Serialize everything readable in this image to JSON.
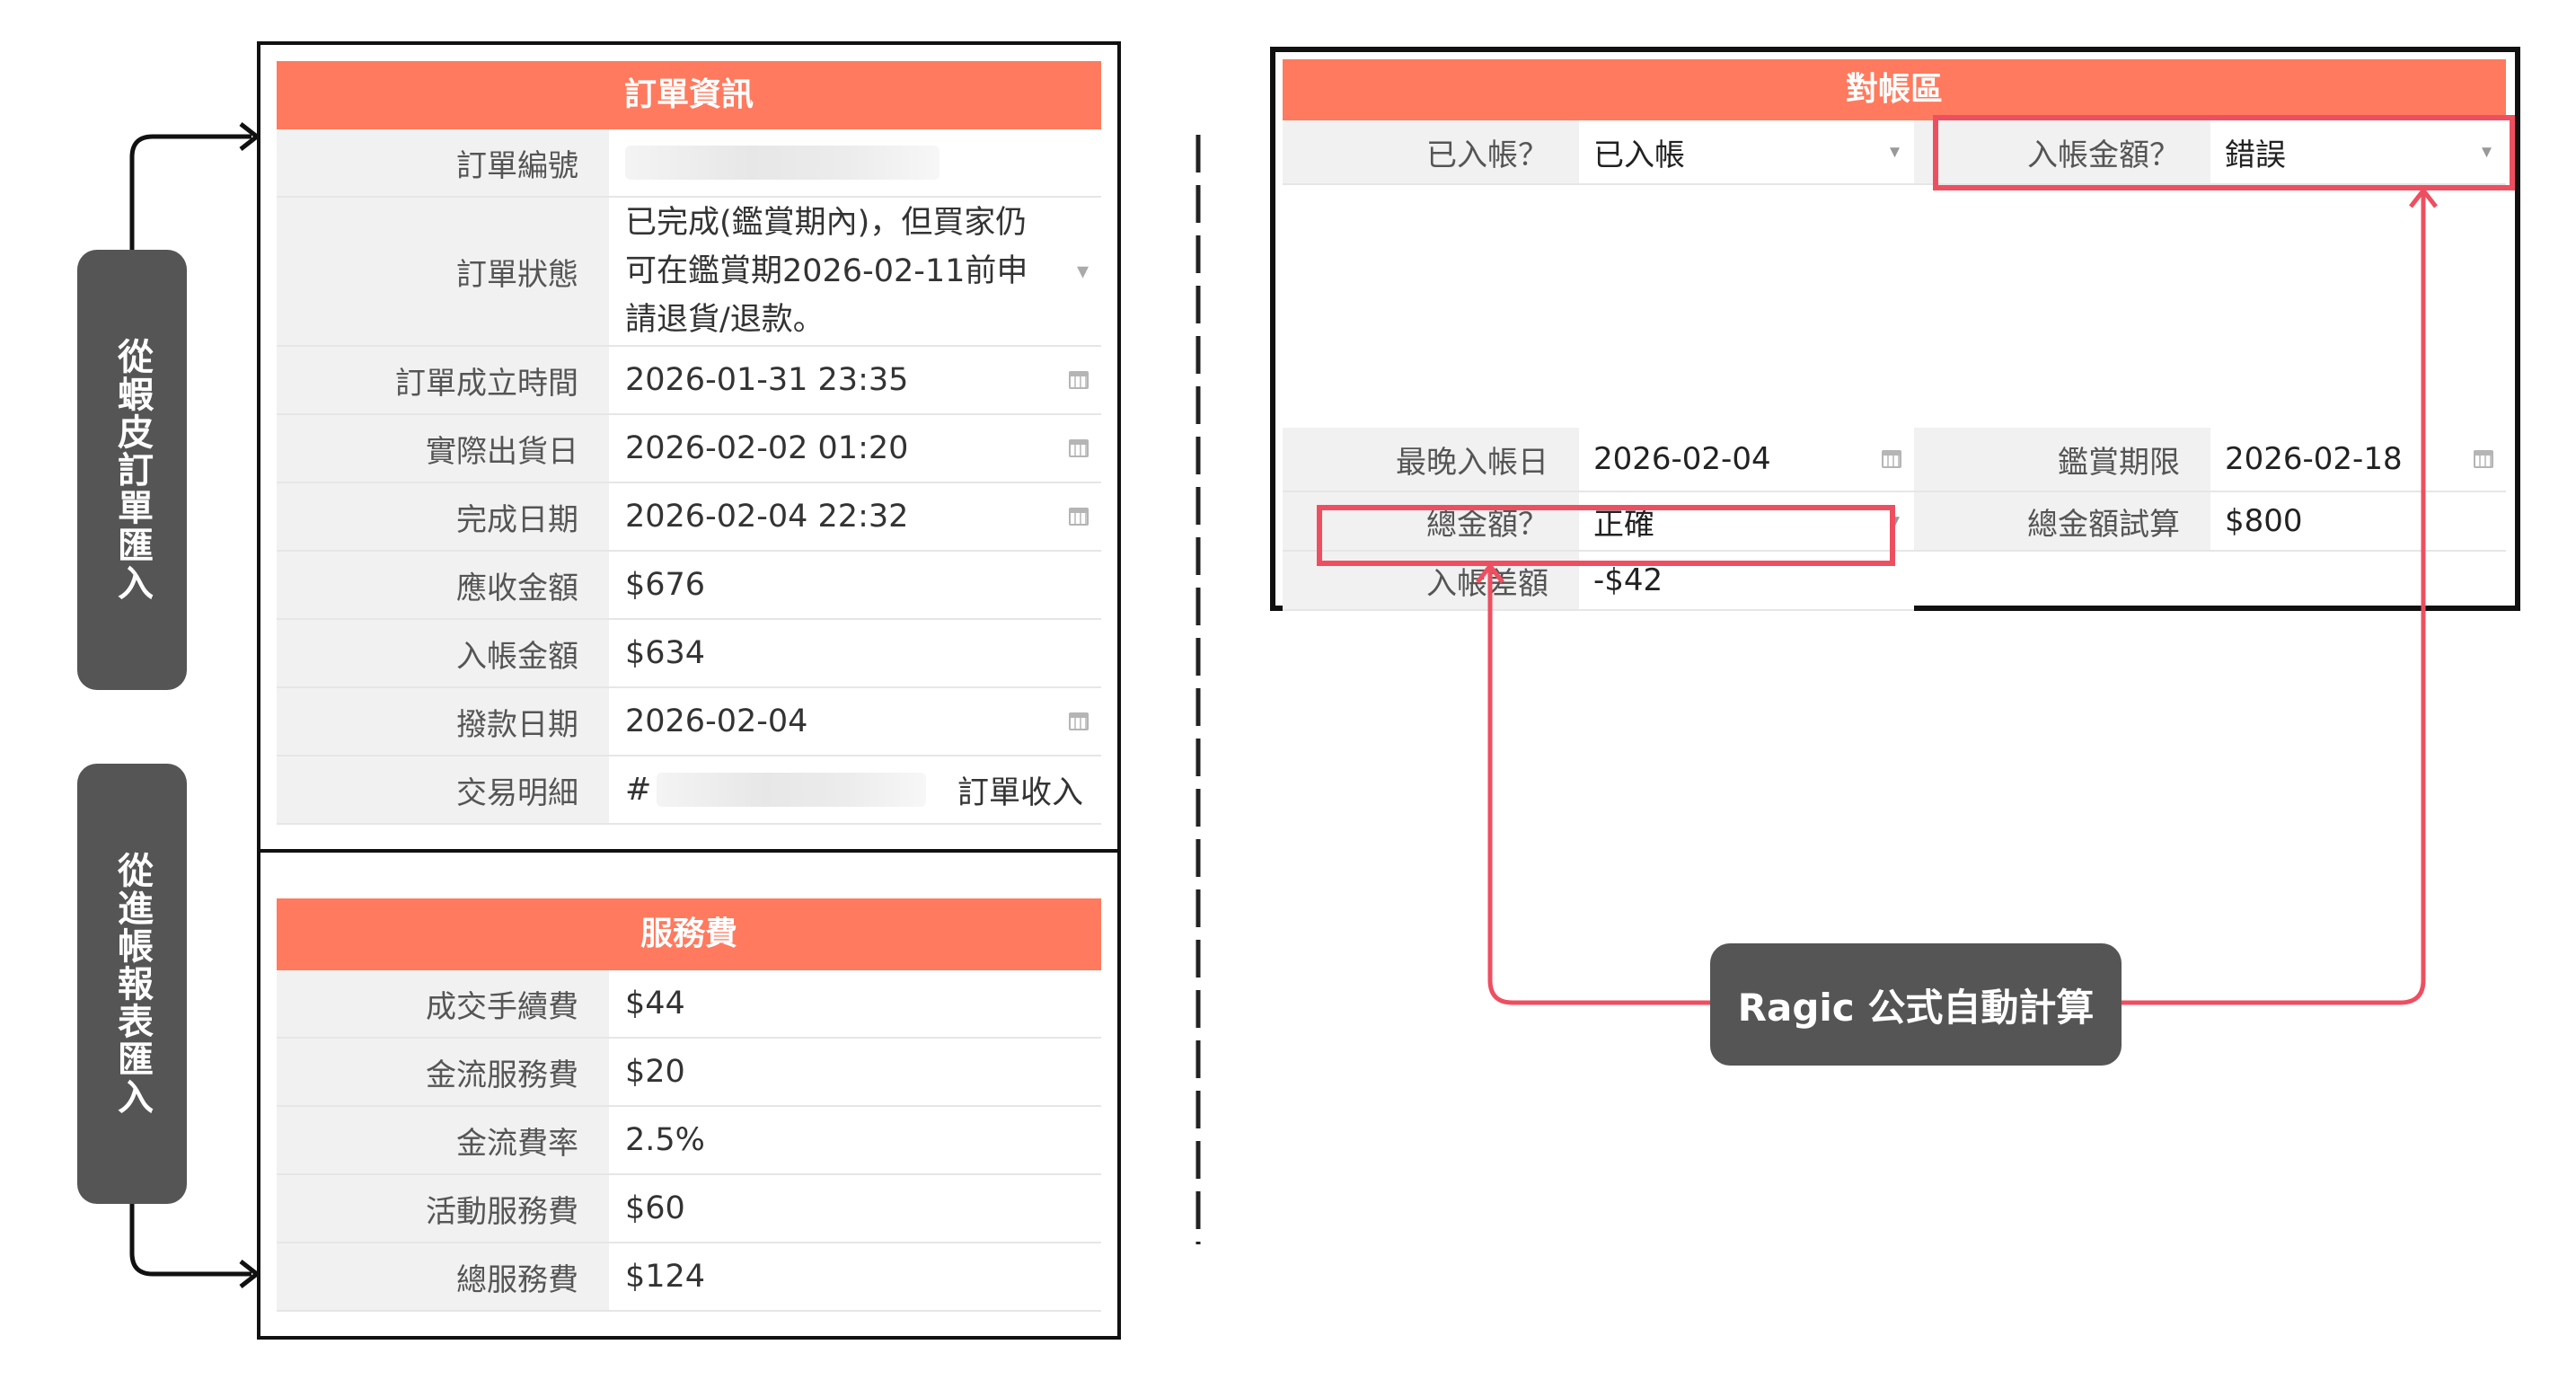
{
  "side_labels": {
    "shopee_import": "從蝦皮訂單匯入",
    "report_import": "從進帳報表匯入"
  },
  "order_info": {
    "header": "訂單資訊",
    "rows": [
      {
        "label": "訂單編號",
        "value": "",
        "kind": "blurred"
      },
      {
        "label": "訂單狀態",
        "value": "已完成(鑑賞期內)，但買家仍可在鑑賞期2026-02-11前申請退貨/退款。",
        "kind": "select"
      },
      {
        "label": "訂單成立時間",
        "value": "2026-01-31 23:35",
        "kind": "date"
      },
      {
        "label": "實際出貨日",
        "value": "2026-02-02 01:20",
        "kind": "date"
      },
      {
        "label": "完成日期",
        "value": "2026-02-04 22:32",
        "kind": "date"
      },
      {
        "label": "應收金額",
        "value": "$676",
        "kind": "text"
      },
      {
        "label": "入帳金額",
        "value": "$634",
        "kind": "text"
      },
      {
        "label": "撥款日期",
        "value": "2026-02-04",
        "kind": "date"
      },
      {
        "label": "交易明細",
        "value_prefix": "#",
        "value_suffix": "訂單收入",
        "kind": "partial-blur"
      }
    ]
  },
  "service_fee": {
    "header": "服務費",
    "rows": [
      {
        "label": "成交手續費",
        "value": "$44"
      },
      {
        "label": "金流服務費",
        "value": "$20"
      },
      {
        "label": "金流費率",
        "value": "2.5%"
      },
      {
        "label": "活動服務費",
        "value": "$60"
      },
      {
        "label": "總服務費",
        "value": "$124"
      }
    ]
  },
  "recon": {
    "header": "對帳區",
    "posted_label": "已入帳？",
    "posted_value": "已入帳",
    "posted_amount_label": "入帳金額？",
    "posted_amount_value": "錯誤",
    "latest_post_label": "最晚入帳日",
    "latest_post_value": "2026-02-04",
    "appraisal_label": "鑑賞期限",
    "appraisal_value": "2026-02-18",
    "total_label": "總金額？",
    "total_value": "正確",
    "total_calc_label": "總金額試算",
    "total_calc_value": "$800",
    "diff_label": "入帳差額",
    "diff_value": "-$42"
  },
  "formula_badge": "Ragic 公式自動計算",
  "colors": {
    "header_orange": "#ff7a5e",
    "highlight_red": "#ee4f60",
    "badge_gray": "#555555"
  }
}
